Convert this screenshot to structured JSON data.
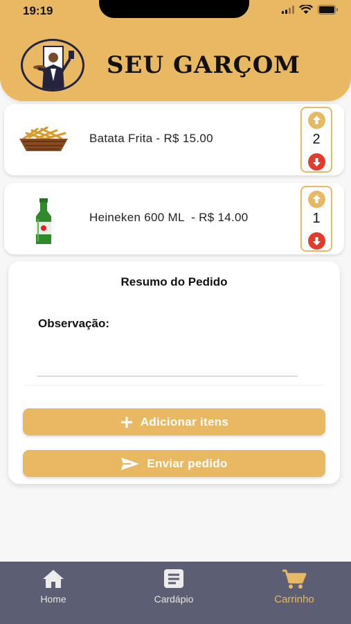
{
  "status_bar": {
    "time": "19:19"
  },
  "header": {
    "title": "SEU GARÇOM"
  },
  "cart_items": [
    {
      "label": "Batata Frita - R$ 15.00",
      "quantity": "2",
      "image_icon": "fries-basket-icon"
    },
    {
      "label": "Heineken 600 ML  - R$ 14.00",
      "quantity": "1",
      "image_icon": "beer-bottle-icon"
    }
  ],
  "summary": {
    "title": "Resumo do Pedido",
    "observation_label": "Observação:",
    "observation_value": "",
    "add_button": "Adicionar itens",
    "send_button": "Enviar pedido"
  },
  "tabs": [
    {
      "label": "Home",
      "icon": "home-icon"
    },
    {
      "label": "Cardápio",
      "icon": "menu-list-icon"
    },
    {
      "label": "Carrinho",
      "icon": "cart-icon",
      "active": true
    }
  ],
  "colors": {
    "accent": "#e9b863",
    "tab_bar": "#5c5f73",
    "down_button": "#e23b2e"
  }
}
